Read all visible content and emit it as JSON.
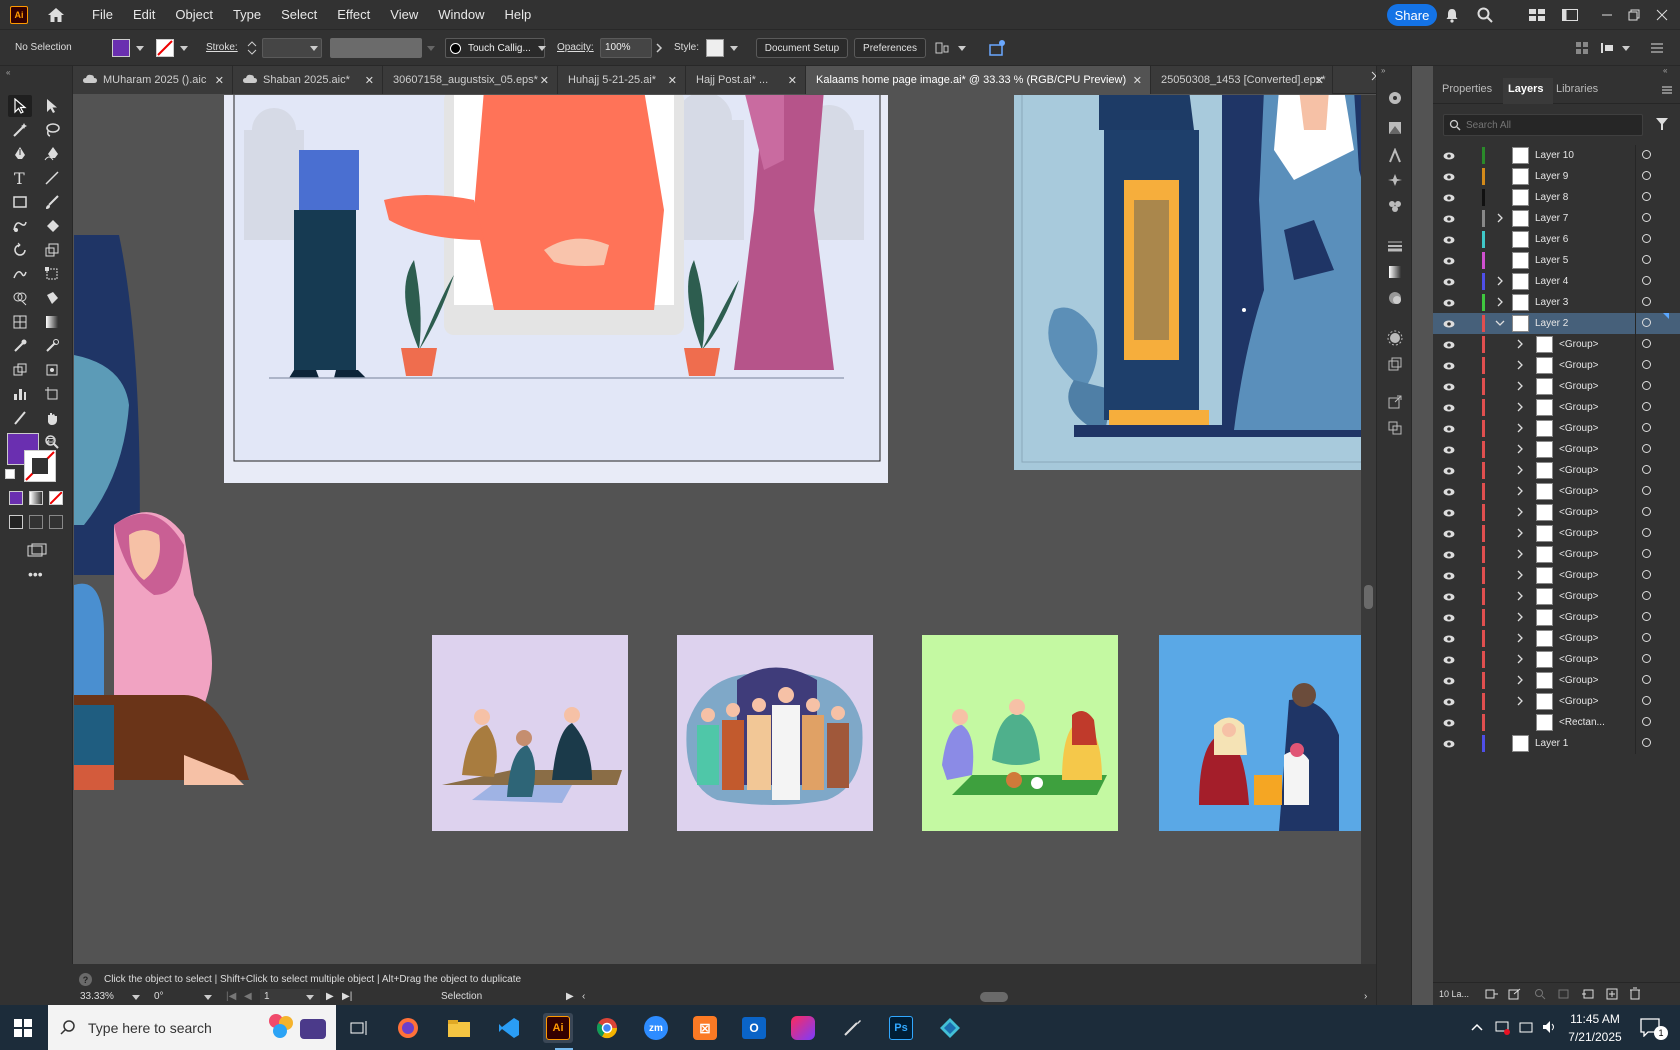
{
  "app": {
    "logo_text": "Ai"
  },
  "menu": [
    "File",
    "Edit",
    "Object",
    "Type",
    "Select",
    "Effect",
    "View",
    "Window",
    "Help"
  ],
  "share_label": "Share",
  "control": {
    "selection": "No Selection",
    "stroke_label": "Stroke:",
    "brush_name": "Touch Callig...",
    "opacity_label": "Opacity:",
    "opacity_value": "100%",
    "style_label": "Style:",
    "document_setup": "Document Setup",
    "preferences": "Preferences",
    "fill_color": "#6a2fb0"
  },
  "tabs": [
    {
      "label": "MUharam 2025 ().aic",
      "active": false
    },
    {
      "label": "Shaban 2025.aic*",
      "active": false
    },
    {
      "label": "30607158_augustsix_05.eps*",
      "active": false
    },
    {
      "label": "Huhajj 5-21-25.ai*",
      "active": false
    },
    {
      "label": "Hajj Post.ai* ...",
      "active": false
    },
    {
      "label": "Kalaams home page image.ai* @ 33.33 % (RGB/CPU Preview)",
      "active": true
    },
    {
      "label": "25050308_1453 [Converted].eps*",
      "active": false
    }
  ],
  "panel_tabs": {
    "properties": "Properties",
    "layers": "Layers",
    "libraries": "Libraries"
  },
  "layers_search_placeholder": "Search All",
  "layers": [
    {
      "name": "Layer 10",
      "color": "#2a8a2a",
      "expandable": false,
      "indent": 0
    },
    {
      "name": "Layer 9",
      "color": "#d38a1a",
      "expandable": false,
      "indent": 0
    },
    {
      "name": "Layer 8",
      "color": "#111111",
      "expandable": false,
      "indent": 0
    },
    {
      "name": "Layer 7",
      "color": "#888888",
      "expandable": true,
      "indent": 0
    },
    {
      "name": "Layer 6",
      "color": "#3fc8c8",
      "expandable": false,
      "indent": 0
    },
    {
      "name": "Layer 5",
      "color": "#d050d0",
      "expandable": false,
      "indent": 0
    },
    {
      "name": "Layer 4",
      "color": "#4f4fe8",
      "expandable": true,
      "indent": 0
    },
    {
      "name": "Layer 3",
      "color": "#3fc83f",
      "expandable": true,
      "indent": 0
    },
    {
      "name": "Layer 2",
      "color": "#e04f4f",
      "expandable": true,
      "indent": 0,
      "selected": true,
      "open": true
    },
    {
      "name": "<Group>",
      "color": "#e04f4f",
      "expandable": true,
      "indent": 1
    },
    {
      "name": "<Group>",
      "color": "#e04f4f",
      "expandable": true,
      "indent": 1
    },
    {
      "name": "<Group>",
      "color": "#e04f4f",
      "expandable": true,
      "indent": 1
    },
    {
      "name": "<Group>",
      "color": "#e04f4f",
      "expandable": true,
      "indent": 1
    },
    {
      "name": "<Group>",
      "color": "#e04f4f",
      "expandable": true,
      "indent": 1
    },
    {
      "name": "<Group>",
      "color": "#e04f4f",
      "expandable": true,
      "indent": 1
    },
    {
      "name": "<Group>",
      "color": "#e04f4f",
      "expandable": true,
      "indent": 1
    },
    {
      "name": "<Group>",
      "color": "#e04f4f",
      "expandable": true,
      "indent": 1
    },
    {
      "name": "<Group>",
      "color": "#e04f4f",
      "expandable": true,
      "indent": 1
    },
    {
      "name": "<Group>",
      "color": "#e04f4f",
      "expandable": true,
      "indent": 1
    },
    {
      "name": "<Group>",
      "color": "#e04f4f",
      "expandable": true,
      "indent": 1
    },
    {
      "name": "<Group>",
      "color": "#e04f4f",
      "expandable": true,
      "indent": 1
    },
    {
      "name": "<Group>",
      "color": "#e04f4f",
      "expandable": true,
      "indent": 1
    },
    {
      "name": "<Group>",
      "color": "#e04f4f",
      "expandable": true,
      "indent": 1
    },
    {
      "name": "<Group>",
      "color": "#e04f4f",
      "expandable": true,
      "indent": 1
    },
    {
      "name": "<Group>",
      "color": "#e04f4f",
      "expandable": true,
      "indent": 1
    },
    {
      "name": "<Group>",
      "color": "#e04f4f",
      "expandable": true,
      "indent": 1
    },
    {
      "name": "<Group>",
      "color": "#e04f4f",
      "expandable": true,
      "indent": 1
    },
    {
      "name": "<Rectan...",
      "color": "#e04f4f",
      "expandable": false,
      "indent": 1
    },
    {
      "name": "Layer 1",
      "color": "#4f4fe8",
      "expandable": false,
      "indent": 0
    }
  ],
  "layers_footer": {
    "count": "10 La..."
  },
  "status": {
    "hint": "Click the object to select  |  Shift+Click to select multiple object  |  Alt+Drag the object to duplicate",
    "zoom": "33.33%",
    "rotation": "0°",
    "artboard": "1",
    "mode": "Selection"
  },
  "taskbar": {
    "search_placeholder": "Type here to search",
    "time": "11:45 AM",
    "date": "7/21/2025",
    "notifications": "1"
  }
}
